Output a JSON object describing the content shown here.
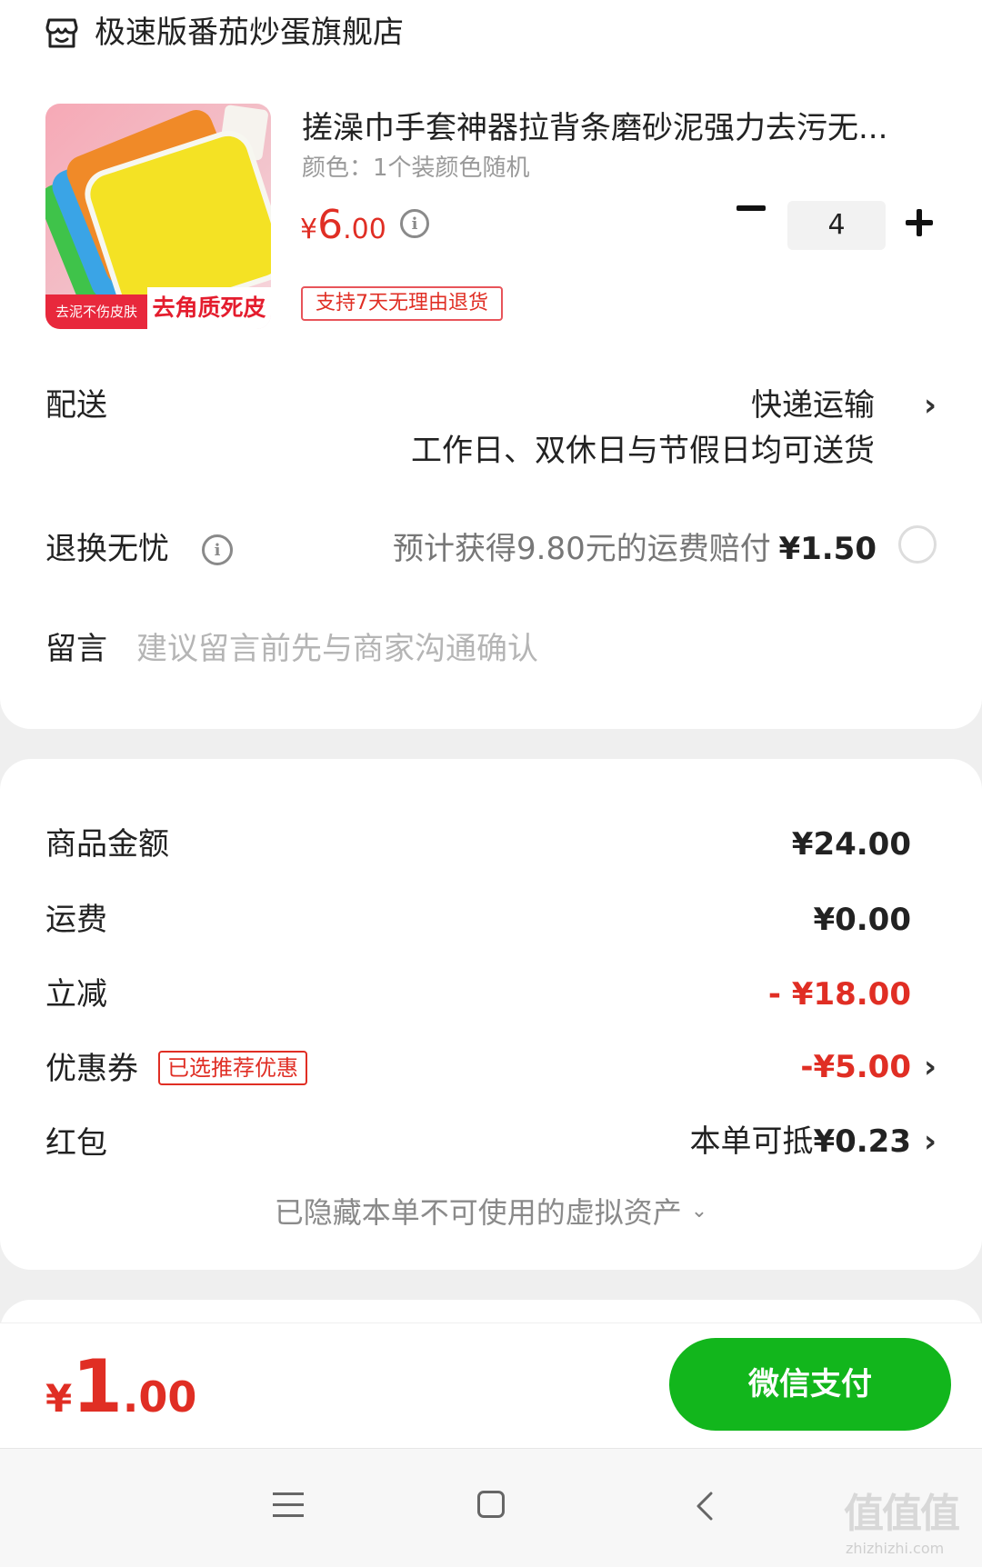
{
  "store": {
    "name": "极速版番茄炒蛋旗舰店",
    "icon": "store-icon"
  },
  "product": {
    "title": "搓澡巾手套神器拉背条磨砂泥强力去污无...",
    "variant": "颜色：1个装颜色随机",
    "price_currency": "¥",
    "price_int": "6",
    "price_dec": ".00",
    "quantity": "4",
    "return_tag": "支持7天无理由退货",
    "image_caption_left": "去泥不伤皮肤",
    "image_caption_right": "去角质死皮"
  },
  "shipping": {
    "label": "配送",
    "method": "快递运输",
    "description": "工作日、双休日与节假日均可送货"
  },
  "return_insurance": {
    "label": "退换无忧",
    "description": "预计获得9.80元的运费赔付",
    "price": "¥1.50"
  },
  "message": {
    "label": "留言",
    "placeholder": "建议留言前先与商家沟通确认"
  },
  "summary": {
    "goods_label": "商品金额",
    "goods_value": "¥24.00",
    "freight_label": "运费",
    "freight_value": "¥0.00",
    "discount_label": "立减",
    "discount_value": "- ¥18.00",
    "coupon_label": "优惠券",
    "coupon_tag": "已选推荐优惠",
    "coupon_value": "-¥5.00",
    "redpacket_label": "红包",
    "redpacket_prefix": "本单可抵",
    "redpacket_value": "¥0.23",
    "hidden_assets": "已隐藏本单不可使用的虚拟资产"
  },
  "payment": {
    "total_currency": "¥",
    "total_int": "1",
    "total_dec": ".00",
    "pay_button": "微信支付"
  },
  "watermark": {
    "text": "值值值",
    "url": "zhizhizhi.com"
  },
  "colors": {
    "accent_red": "#e02e24",
    "pay_green": "#12b61c"
  }
}
